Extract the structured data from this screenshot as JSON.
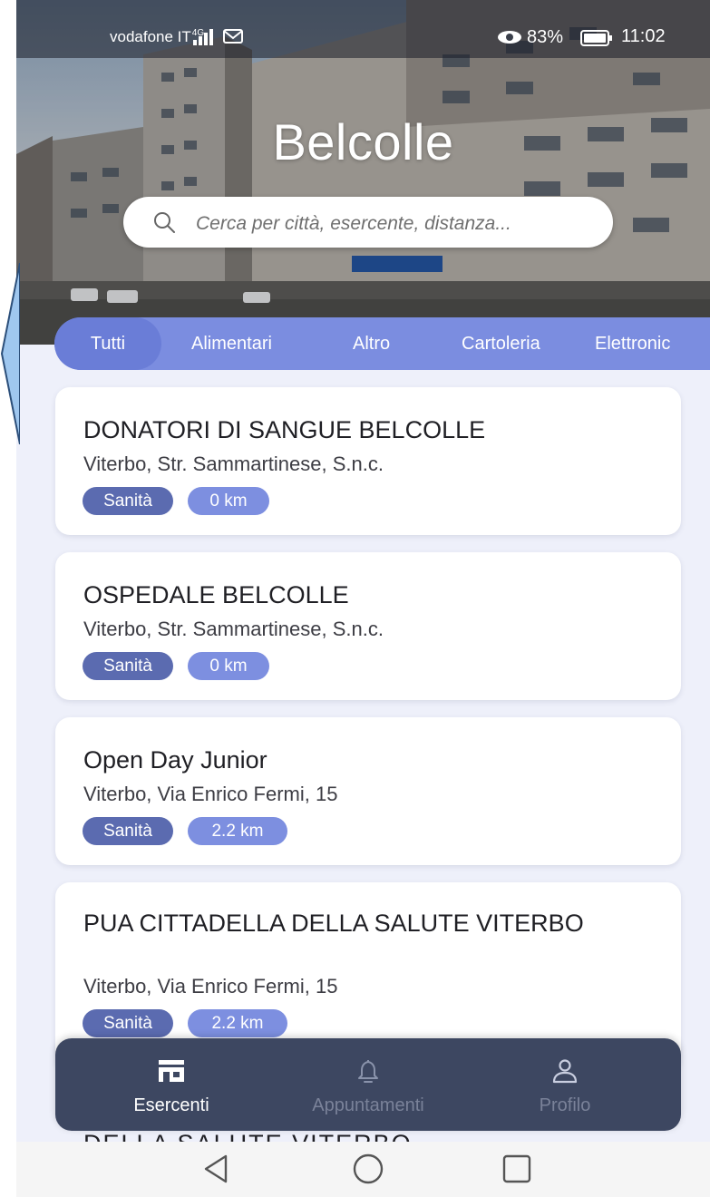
{
  "status_bar": {
    "carrier": "vodafone IT",
    "network": "4G",
    "battery_percent": "83%",
    "time": "11:02"
  },
  "header": {
    "title": "Belcolle",
    "search_placeholder": "Cerca per città, esercente, distanza..."
  },
  "tabs": [
    {
      "label": "Tutti",
      "active": true
    },
    {
      "label": "Alimentari",
      "active": false
    },
    {
      "label": "Altro",
      "active": false
    },
    {
      "label": "Cartoleria",
      "active": false
    },
    {
      "label": "Elettronic",
      "active": false
    }
  ],
  "listings": [
    {
      "name": "DONATORI DI SANGUE BELCOLLE",
      "address": "Viterbo, Str. Sammartinese, S.n.c.",
      "category": "Sanità",
      "distance": "0 km"
    },
    {
      "name": "OSPEDALE BELCOLLE",
      "address": "Viterbo, Str. Sammartinese, S.n.c.",
      "category": "Sanità",
      "distance": "0 km"
    },
    {
      "name": "Open Day Junior",
      "address": "Viterbo, Via Enrico Fermi, 15",
      "category": "Sanità",
      "distance": "2.2 km"
    },
    {
      "name": "PUA CITTADELLA DELLA SALUTE VITERBO",
      "address": "Viterbo, Via Enrico Fermi, 15",
      "category": "Sanità",
      "distance": "2.2 km"
    }
  ],
  "partial_next_item_text": "DELLA SALUTE VITERBO",
  "bottom_nav": [
    {
      "label": "Esercenti",
      "icon": "store-icon",
      "active": true
    },
    {
      "label": "Appuntamenti",
      "icon": "bell-icon",
      "active": false
    },
    {
      "label": "Profilo",
      "icon": "user-icon",
      "active": false
    }
  ],
  "colors": {
    "tab_bar": "#7b8de0",
    "tab_active": "#6a7dd7",
    "category_badge": "#5b6bb0",
    "distance_badge": "#7d8fe0",
    "bottom_nav_bg": "#3d4761",
    "background": "#eef0fa"
  }
}
